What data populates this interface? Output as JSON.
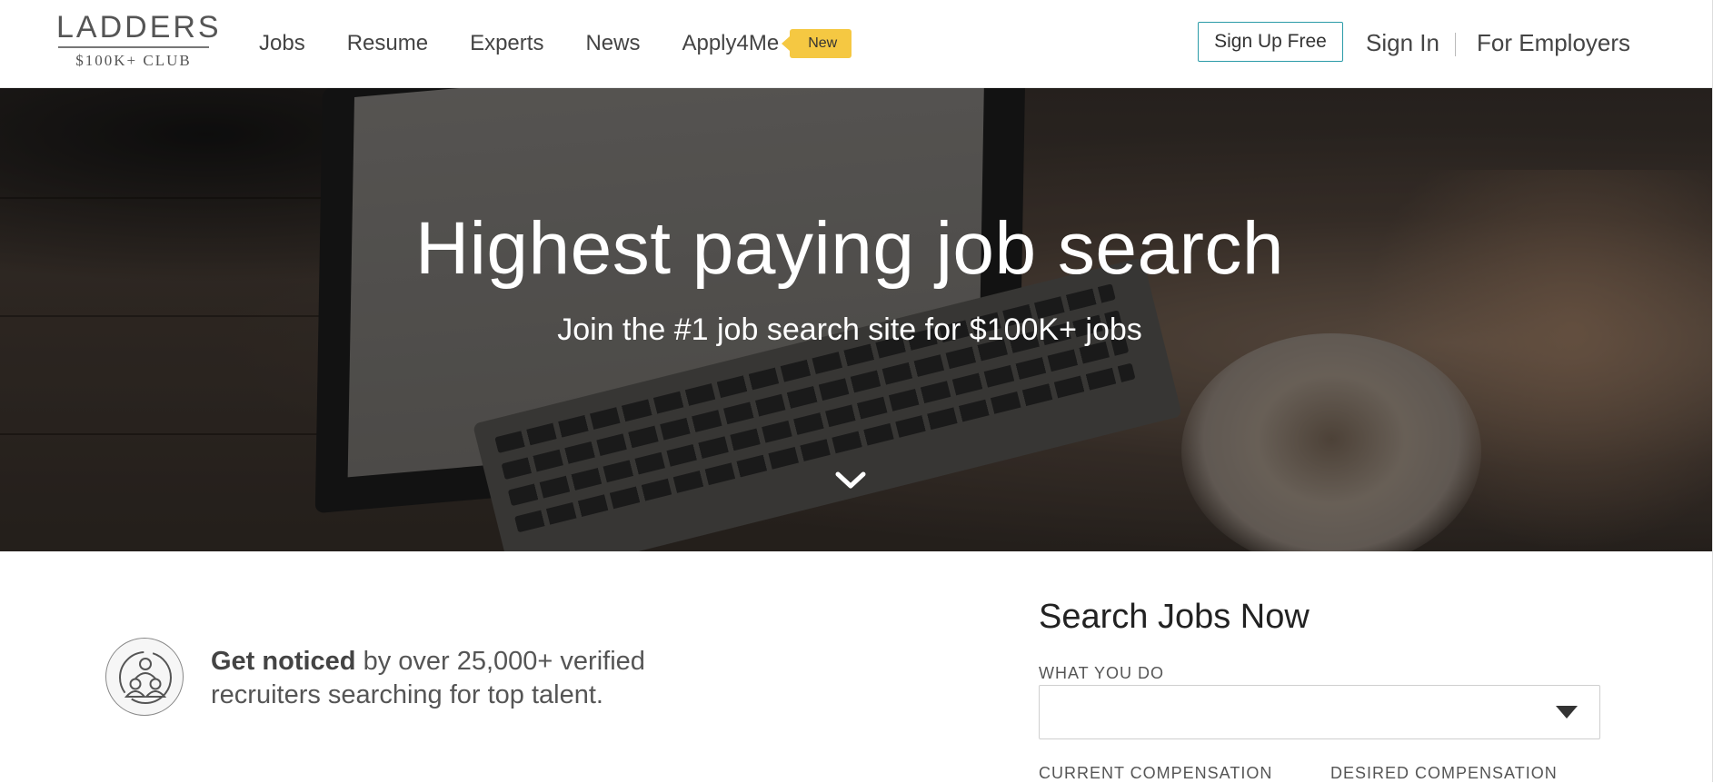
{
  "header": {
    "logo_top": "LADDERS",
    "logo_bottom": "$100K+ CLUB",
    "nav": {
      "jobs": "Jobs",
      "resume": "Resume",
      "experts": "Experts",
      "news": "News",
      "apply4me": "Apply4Me",
      "new_badge": "New"
    },
    "signup_label": "Sign Up Free",
    "signin_label": "Sign In",
    "employers_label": "For Employers"
  },
  "hero": {
    "title": "Highest paying job search",
    "subtitle": "Join the #1 job search site for $100K+ jobs"
  },
  "notice": {
    "bold": "Get noticed",
    "rest": " by over 25,000+ verified recruiters searching for top talent."
  },
  "search": {
    "title": "Search Jobs Now",
    "what_you_do_label": "WHAT YOU DO",
    "what_you_do_value": "",
    "current_comp_label": "CURRENT COMPENSATION",
    "desired_comp_label": "DESIRED COMPENSATION"
  },
  "colors": {
    "accent_border": "#2a9ba8",
    "badge": "#f5c842"
  }
}
